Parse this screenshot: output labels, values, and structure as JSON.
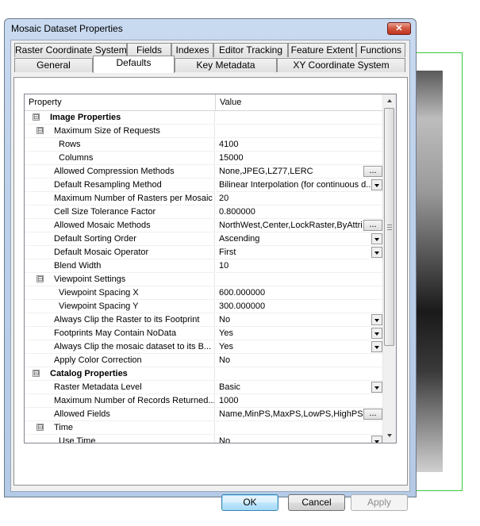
{
  "window": {
    "title": "Mosaic Dataset Properties",
    "close_glyph": "✕"
  },
  "tabs_row1": [
    "Raster Coordinate System",
    "Fields",
    "Indexes",
    "Editor Tracking",
    "Feature Extent",
    "Functions"
  ],
  "tabs_row2": [
    "General",
    "Defaults",
    "Key Metadata",
    "XY Coordinate System"
  ],
  "active_tab": "Defaults",
  "grid": {
    "header_property": "Property",
    "header_value": "Value",
    "rows": [
      {
        "label": "Image Properties",
        "value": "",
        "level": 0,
        "toggle": "⊟",
        "bold": true
      },
      {
        "label": "Maximum Size of Requests",
        "value": "",
        "level": 1,
        "toggle": "⊟"
      },
      {
        "label": "Rows",
        "value": "4100",
        "level": 2
      },
      {
        "label": "Columns",
        "value": "15000",
        "level": 2
      },
      {
        "label": "Allowed Compression Methods",
        "value": "None,JPEG,LZ77,LERC",
        "level": 1,
        "control": "ellipsis"
      },
      {
        "label": "Default Resampling Method",
        "value": "Bilinear Interpolation (for continuous d...",
        "level": 1,
        "control": "dropdown"
      },
      {
        "label": "Maximum Number of Rasters per Mosaic",
        "value": "20",
        "level": 1
      },
      {
        "label": "Cell Size Tolerance Factor",
        "value": "0.800000",
        "level": 1
      },
      {
        "label": "Allowed Mosaic Methods",
        "value": "NorthWest,Center,LockRaster,ByAttri...",
        "level": 1,
        "control": "ellipsis"
      },
      {
        "label": "Default Sorting Order",
        "value": "Ascending",
        "level": 1,
        "control": "dropdown"
      },
      {
        "label": "Default Mosaic Operator",
        "value": "First",
        "level": 1,
        "control": "dropdown"
      },
      {
        "label": "Blend Width",
        "value": "10",
        "level": 1
      },
      {
        "label": "Viewpoint Settings",
        "value": "",
        "level": 1,
        "toggle": "⊟"
      },
      {
        "label": "Viewpoint Spacing X",
        "value": "600.000000",
        "level": 2
      },
      {
        "label": "Viewpoint Spacing Y",
        "value": "300.000000",
        "level": 2
      },
      {
        "label": "Always Clip the Raster to its Footprint",
        "value": "No",
        "level": 1,
        "control": "dropdown"
      },
      {
        "label": "Footprints May Contain NoData",
        "value": "Yes",
        "level": 1,
        "control": "dropdown"
      },
      {
        "label": "Always Clip the mosaic dataset to its B...",
        "value": "Yes",
        "level": 1,
        "control": "dropdown"
      },
      {
        "label": "Apply Color Correction",
        "value": "No",
        "level": 1
      },
      {
        "label": "Catalog Properties",
        "value": "",
        "level": 0,
        "toggle": "⊟",
        "bold": true
      },
      {
        "label": "Raster Metadata Level",
        "value": "Basic",
        "level": 1,
        "control": "dropdown"
      },
      {
        "label": "Maximum Number of Records Returned...",
        "value": "1000",
        "level": 1
      },
      {
        "label": "Allowed Fields",
        "value": "Name,MinPS,MaxPS,LowPS,HighPS,Ta...",
        "level": 1,
        "control": "ellipsis"
      },
      {
        "label": "Time",
        "value": "",
        "level": 1,
        "toggle": "⊟"
      },
      {
        "label": "Use Time",
        "value": "No",
        "level": 2,
        "control": "dropdown"
      }
    ],
    "ellipsis_label": "..."
  },
  "buttons": {
    "ok": "OK",
    "cancel": "Cancel",
    "apply": "Apply"
  }
}
